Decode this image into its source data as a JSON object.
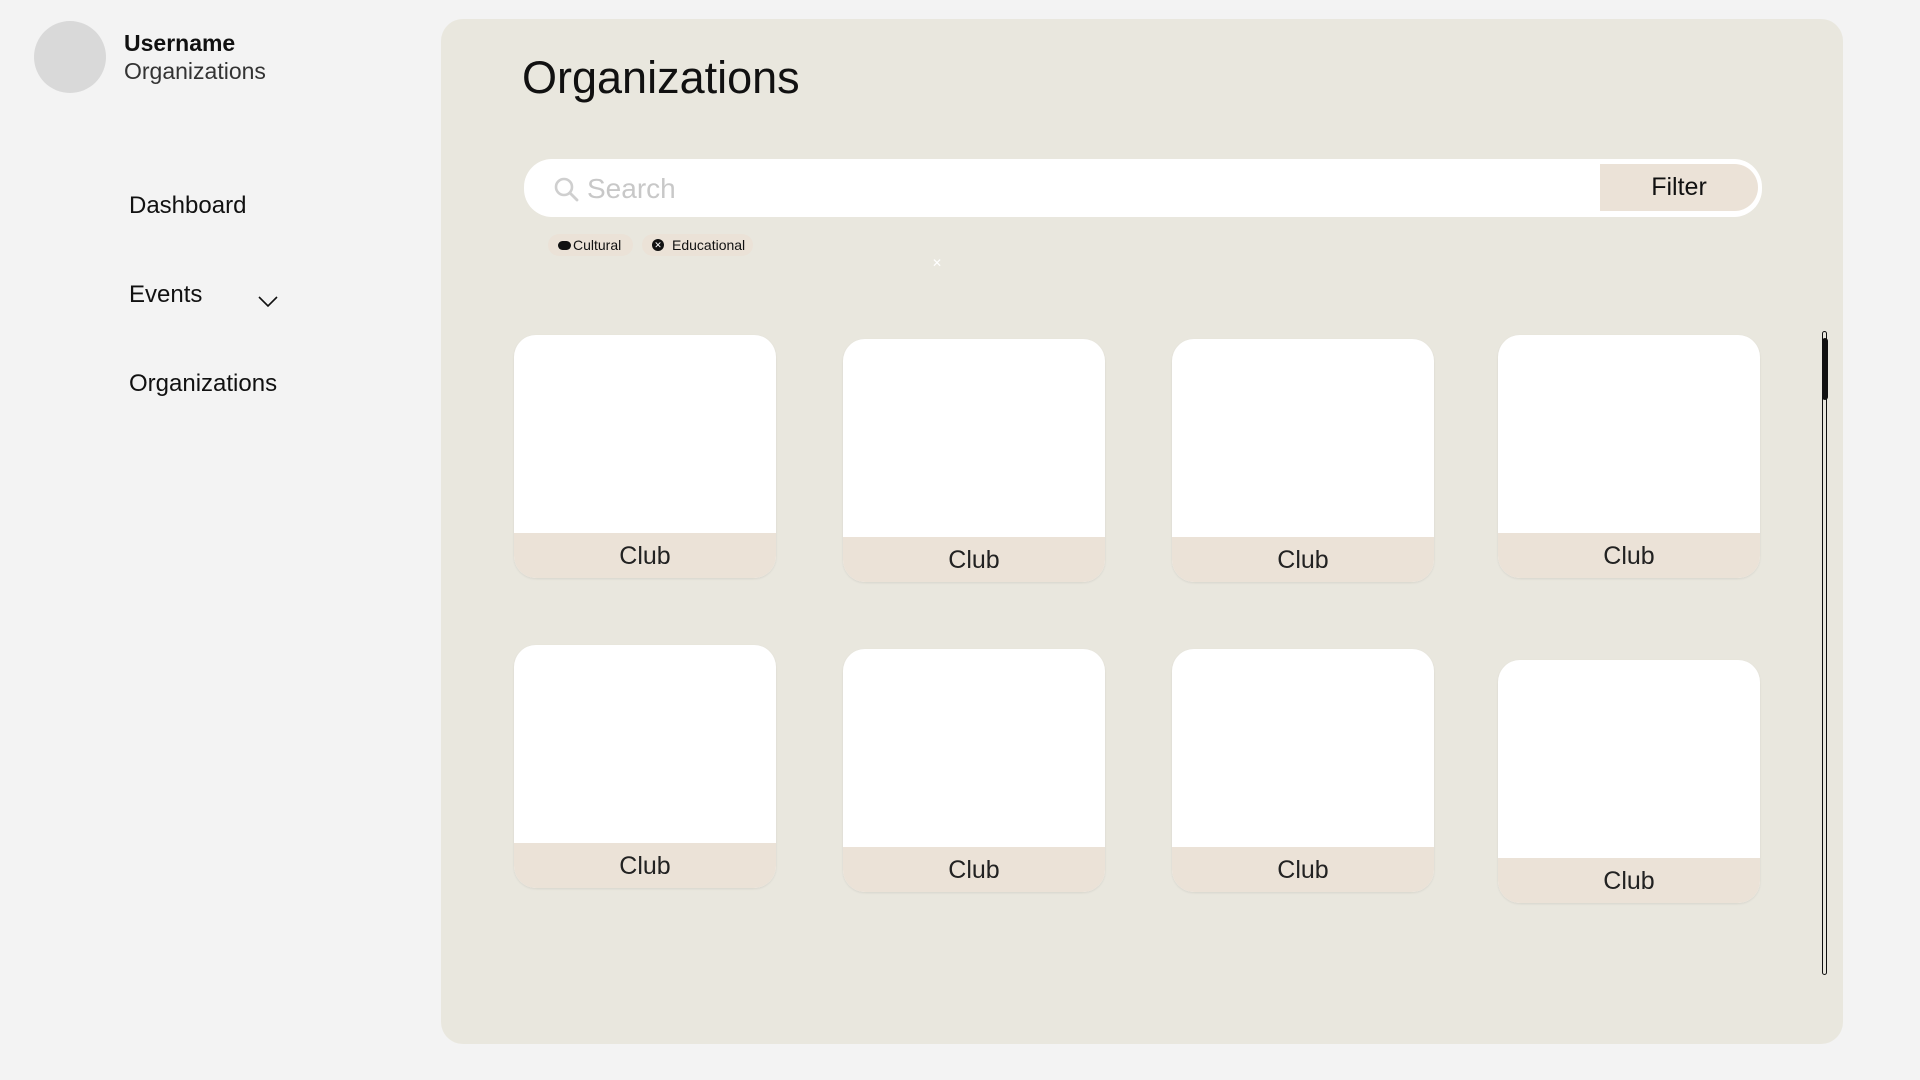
{
  "user": {
    "name": "Username",
    "subtitle": "Organizations"
  },
  "nav": {
    "dashboard": "Dashboard",
    "events": "Events",
    "organizations": "Organizations"
  },
  "main": {
    "title": "Organizations",
    "search_placeholder": "Search",
    "filter_label": "Filter",
    "chips": [
      "Cultural",
      "Educational"
    ],
    "cards": [
      "Club",
      "Club",
      "Club",
      "Club",
      "Club",
      "Club",
      "Club",
      "Club"
    ]
  },
  "colors": {
    "page_bg": "#f3f3f3",
    "panel_bg": "#e9e7de",
    "accent": "#ebe2d7",
    "card_bg": "#ffffff"
  },
  "icons": {
    "search": "search-icon",
    "events_expand": "chevron-down-icon",
    "chip_cultural": "dot-icon",
    "chip_educational": "close-icon"
  }
}
